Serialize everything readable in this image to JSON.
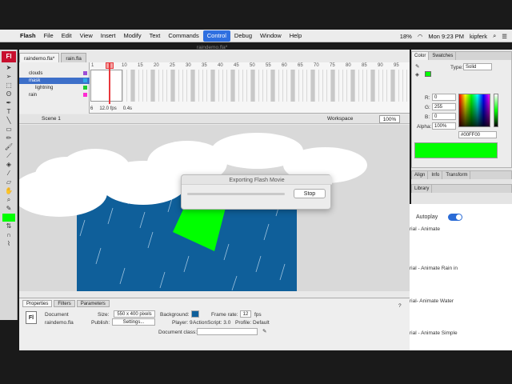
{
  "menubar": {
    "app": "Flash",
    "items": [
      "File",
      "Edit",
      "View",
      "Insert",
      "Modify",
      "Text",
      "Commands",
      "Control",
      "Debug",
      "Window",
      "Help"
    ],
    "active": "Control",
    "battery": "18%",
    "clock": "Mon 9:23 PM",
    "user": "kipferk"
  },
  "document": {
    "tabs": [
      "raindemo.fla*",
      "rain.fla"
    ],
    "window_title": "raindemo.fla*"
  },
  "timeline": {
    "layers": [
      {
        "name": "clouds",
        "color": "#9c4fd6"
      },
      {
        "name": "mask",
        "color": "#2fa7e8"
      },
      {
        "name": "lightning",
        "color": "#1fcb2e"
      },
      {
        "name": "rain",
        "color": "#ff2bd2"
      }
    ],
    "selected_layer": "mask",
    "frame_numbers": [
      "1",
      "5",
      "10",
      "15",
      "20",
      "25",
      "30",
      "35",
      "40",
      "45",
      "50",
      "55",
      "60",
      "65",
      "70",
      "75",
      "80",
      "85",
      "90",
      "95"
    ],
    "current_frame": "6",
    "fps": "12.0 fps",
    "elapsed": "0.4s"
  },
  "scene": {
    "name": "Scene 1",
    "workspace": "Workspace",
    "zoom": "100%"
  },
  "dialog": {
    "title": "Exporting Flash Movie",
    "stop_label": "Stop",
    "progress": 0.0
  },
  "properties": {
    "tabs": [
      "Properties",
      "Filters",
      "Parameters"
    ],
    "type": "Document",
    "filename": "raindemo.fla",
    "size_label": "Size:",
    "size": "550 x 400 pixels",
    "background_label": "Background:",
    "background_color": "#0f5f9a",
    "framerate_label": "Frame rate:",
    "framerate": "12",
    "fps": "fps",
    "publish_label": "Publish:",
    "settings_button": "Settings...",
    "player": "Player: 9",
    "actionscript": "ActionScript: 3.0",
    "profile": "Profile:  Default",
    "docclass_label": "Document class:"
  },
  "colorpanel": {
    "tabs": [
      "Color",
      "Swatches"
    ],
    "type_label": "Type:",
    "type_value": "Solid",
    "r_label": "R:",
    "r": "0",
    "g_label": "G:",
    "g": "255",
    "b_label": "B:",
    "b": "0",
    "alpha_label": "Alpha:",
    "alpha": "100%",
    "hex": "#00FF00",
    "preview_color": "#00ff00"
  },
  "alignpanel": {
    "tabs": [
      "Align",
      "Info",
      "Transform"
    ]
  },
  "librarypanel": {
    "tabs": [
      "Library"
    ]
  },
  "web": {
    "autoplay": "Autoplay",
    "videos": [
      "rial - Animate",
      "rial - Animate Rain in",
      "rial- Animate Water",
      "rial - Animate Simple"
    ]
  }
}
